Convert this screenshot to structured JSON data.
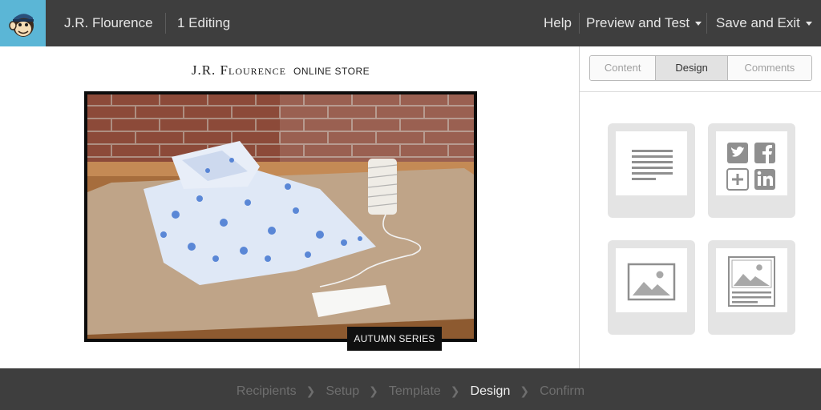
{
  "header": {
    "brand_name": "J.R. Flourence",
    "editing_status": "1 Editing",
    "help_label": "Help",
    "preview_label": "Preview and Test",
    "save_label": "Save and Exit"
  },
  "email": {
    "store_name": "J.R. Flourence",
    "store_subtitle": "ONLINE STORE",
    "hero_caption": "AUTUMN SERIES"
  },
  "panel": {
    "tabs": [
      {
        "label": "Content"
      },
      {
        "label": "Design"
      },
      {
        "label": "Comments"
      }
    ],
    "active_tab": "Design",
    "blocks": [
      {
        "icon": "text-block-icon"
      },
      {
        "icon": "social-share-block-icon"
      },
      {
        "icon": "image-block-icon"
      },
      {
        "icon": "image-with-caption-block-icon"
      }
    ]
  },
  "footer": {
    "steps": [
      {
        "label": "Recipients"
      },
      {
        "label": "Setup"
      },
      {
        "label": "Template"
      },
      {
        "label": "Design"
      },
      {
        "label": "Confirm"
      }
    ],
    "current_step": "Design"
  },
  "colors": {
    "topbar": "#3e3e3e",
    "logo_bg": "#5bb6d6",
    "active_tab_bg": "#e2e2e2",
    "block_bg": "#e4e4e4"
  }
}
